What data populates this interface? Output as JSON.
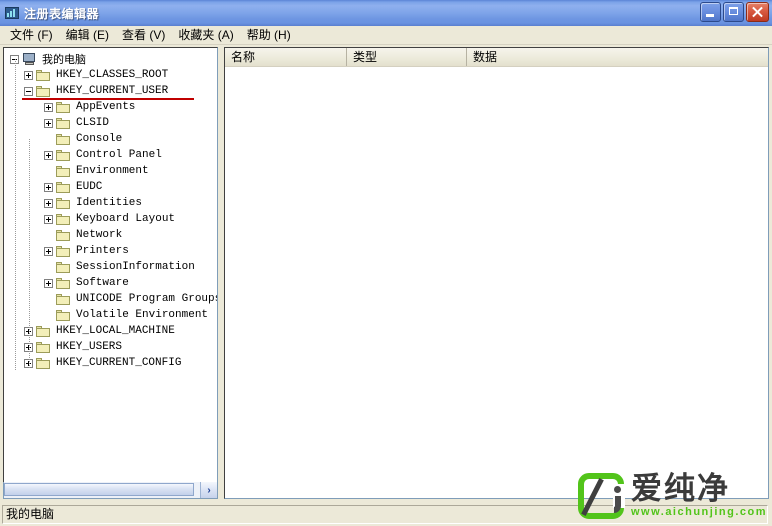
{
  "window": {
    "title": "注册表编辑器",
    "icon": "regedit-icon",
    "minimize_label": "最小化",
    "maximize_label": "最大化",
    "close_label": "关闭"
  },
  "menubar": {
    "items": [
      {
        "label": "文件 (F)"
      },
      {
        "label": "编辑 (E)"
      },
      {
        "label": "查看 (V)"
      },
      {
        "label": "收藏夹 (A)"
      },
      {
        "label": "帮助 (H)"
      }
    ]
  },
  "tree": {
    "nodes": [
      {
        "label": "我的电脑",
        "level": 0,
        "expander": "minus",
        "icon": "computer-icon",
        "annotated": false
      },
      {
        "label": "HKEY_CLASSES_ROOT",
        "level": 1,
        "expander": "plus",
        "icon": "folder-icon",
        "annotated": false
      },
      {
        "label": "HKEY_CURRENT_USER",
        "level": 1,
        "expander": "minus",
        "icon": "folder-icon",
        "annotated": true
      },
      {
        "label": "AppEvents",
        "level": 2,
        "expander": "plus",
        "icon": "folder-icon",
        "annotated": false
      },
      {
        "label": "CLSID",
        "level": 2,
        "expander": "plus",
        "icon": "folder-icon",
        "annotated": false
      },
      {
        "label": "Console",
        "level": 2,
        "expander": "none",
        "icon": "folder-icon",
        "annotated": false
      },
      {
        "label": "Control Panel",
        "level": 2,
        "expander": "plus",
        "icon": "folder-icon",
        "annotated": false
      },
      {
        "label": "Environment",
        "level": 2,
        "expander": "none",
        "icon": "folder-icon",
        "annotated": false
      },
      {
        "label": "EUDC",
        "level": 2,
        "expander": "plus",
        "icon": "folder-icon",
        "annotated": false
      },
      {
        "label": "Identities",
        "level": 2,
        "expander": "plus",
        "icon": "folder-icon",
        "annotated": false
      },
      {
        "label": "Keyboard Layout",
        "level": 2,
        "expander": "plus",
        "icon": "folder-icon",
        "annotated": false
      },
      {
        "label": "Network",
        "level": 2,
        "expander": "none",
        "icon": "folder-icon",
        "annotated": false
      },
      {
        "label": "Printers",
        "level": 2,
        "expander": "plus",
        "icon": "folder-icon",
        "annotated": false
      },
      {
        "label": "SessionInformation",
        "level": 2,
        "expander": "none",
        "icon": "folder-icon",
        "annotated": false
      },
      {
        "label": "Software",
        "level": 2,
        "expander": "plus",
        "icon": "folder-icon",
        "annotated": false
      },
      {
        "label": "UNICODE Program Groups",
        "level": 2,
        "expander": "none",
        "icon": "folder-icon",
        "annotated": false
      },
      {
        "label": "Volatile Environment",
        "level": 2,
        "expander": "none",
        "icon": "folder-icon",
        "annotated": false
      },
      {
        "label": "HKEY_LOCAL_MACHINE",
        "level": 1,
        "expander": "plus",
        "icon": "folder-icon",
        "annotated": false
      },
      {
        "label": "HKEY_USERS",
        "level": 1,
        "expander": "plus",
        "icon": "folder-icon",
        "annotated": false
      },
      {
        "label": "HKEY_CURRENT_CONFIG",
        "level": 1,
        "expander": "plus",
        "icon": "folder-icon",
        "annotated": false
      }
    ],
    "scroll_right_glyph": "›"
  },
  "list": {
    "columns": [
      {
        "label": "名称"
      },
      {
        "label": "类型"
      },
      {
        "label": "数据"
      }
    ],
    "rows": []
  },
  "statusbar": {
    "path": "我的电脑"
  },
  "watermark": {
    "brand": "爱纯净",
    "url": "www.aichunjing.com",
    "accent_color": "#52c41a"
  },
  "colors": {
    "titlebar_blue": "#7ea4e9",
    "window_face": "#ece9d8",
    "annotation_red": "#c00000",
    "panel_border": "#7f9db9"
  }
}
